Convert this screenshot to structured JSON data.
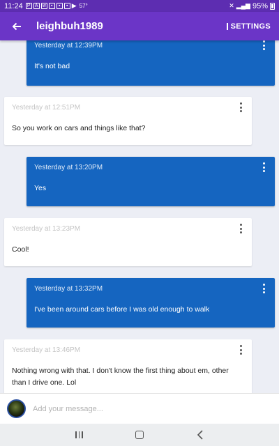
{
  "status_bar": {
    "time": "11:24",
    "temperature": "57°",
    "battery": "95%"
  },
  "app_bar": {
    "title": "leighbuh1989",
    "settings_label": "SETTINGS"
  },
  "messages": [
    {
      "sender": "me",
      "timestamp": "Yesterday at 12:39PM",
      "text": "It's not bad"
    },
    {
      "sender": "them",
      "timestamp": "Yesterday at 12:51PM",
      "text": "So you work on cars and things like that?"
    },
    {
      "sender": "me",
      "timestamp": "Yesterday at 13:20PM",
      "text": "Yes"
    },
    {
      "sender": "them",
      "timestamp": "Yesterday at 13:23PM",
      "text": "Cool!"
    },
    {
      "sender": "me",
      "timestamp": "Yesterday at 13:32PM",
      "text": "I've been around cars before I was old enough to walk"
    },
    {
      "sender": "them",
      "timestamp": "Yesterday at 13:46PM",
      "text": "Nothing wrong with that. I don't know the first thing about em, other than I drive one. Lol"
    }
  ],
  "composer": {
    "placeholder": "Add your message..."
  },
  "colors": {
    "status_bar": "#5d2db1",
    "app_bar": "#6b35c7",
    "my_bubble": "#1565c0",
    "their_bubble": "#ffffff",
    "background": "#eceef5"
  },
  "icons": {
    "back": "arrow-left-icon",
    "settings": "settings-icon",
    "more": "kebab-menu-icon",
    "nav_recents": "recents-icon",
    "nav_home": "home-icon",
    "nav_back": "chevron-left-icon"
  }
}
